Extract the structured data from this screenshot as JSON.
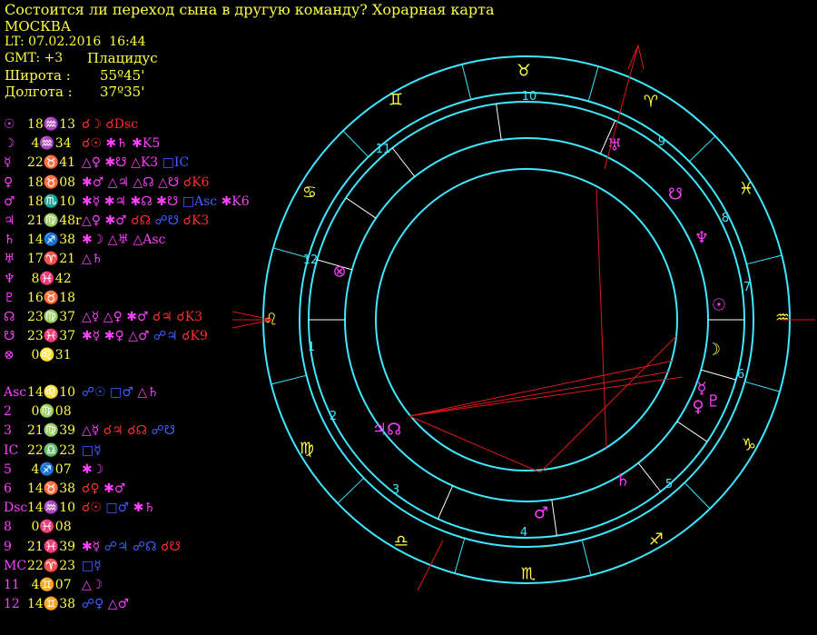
{
  "header": {
    "title": "Состоится ли переход сына в другую команду? Хорарная карта",
    "city": "МОСКВА",
    "lt": "LT: 07.02.2016  16:44",
    "gmt": "GMT: +3",
    "system": "Плацидус",
    "lat_label": "Широта :",
    "lat_value": "55º45'",
    "lon_label": "Долгота :",
    "lon_value": "37º35'"
  },
  "colors": {
    "text": "#ffff40",
    "magenta": "#ff40ff",
    "red": "#ff3030",
    "blue": "#4060ff",
    "cyan": "#40e8ff",
    "line": "#e01818"
  },
  "planets": [
    {
      "glyph": "☉",
      "pos": "18♒13",
      "aspects": [
        {
          "t": "☌☽ ☌Dsc",
          "c": "#ff3030"
        }
      ]
    },
    {
      "glyph": "☽",
      "pos": " 4♒34",
      "aspects": [
        {
          "t": "☌☉ ",
          "c": "#ff3030"
        },
        {
          "t": "✱♄ ✱K5",
          "c": "#ff40ff"
        }
      ]
    },
    {
      "glyph": "☿",
      "pos": "22♉41",
      "aspects": [
        {
          "t": "△♀ ✱☋ △K3 ",
          "c": "#ff40ff"
        },
        {
          "t": "□IC",
          "c": "#4060ff"
        }
      ]
    },
    {
      "glyph": "♀",
      "pos": "18♉08",
      "aspects": [
        {
          "t": "✱♂ △♃ △☊ △☋ ",
          "c": "#ff40ff"
        },
        {
          "t": "☌K6",
          "c": "#ff3030"
        }
      ]
    },
    {
      "glyph": "♂",
      "pos": "18♏10",
      "aspects": [
        {
          "t": "✱☿ ✱♃ ✱☊ ✱☋ ",
          "c": "#ff40ff"
        },
        {
          "t": "□Asc ",
          "c": "#4060ff"
        },
        {
          "t": "✱K6",
          "c": "#ff40ff"
        }
      ]
    },
    {
      "glyph": "♃",
      "pos": "21♍48r",
      "aspects": [
        {
          "t": "△♀ ✱♂ ",
          "c": "#ff40ff"
        },
        {
          "t": "☌☊ ",
          "c": "#ff3030"
        },
        {
          "t": "☍☋ ",
          "c": "#4060ff"
        },
        {
          "t": "☌K3",
          "c": "#ff3030"
        }
      ]
    },
    {
      "glyph": "♄",
      "pos": "14♐38",
      "aspects": [
        {
          "t": "✱☽ △♅ △Asc",
          "c": "#ff40ff"
        }
      ]
    },
    {
      "glyph": "♅",
      "pos": "17♈21",
      "aspects": [
        {
          "t": "△♄",
          "c": "#ff40ff"
        }
      ]
    },
    {
      "glyph": "♆",
      "pos": " 8♓42",
      "aspects": []
    },
    {
      "glyph": "♇",
      "pos": "16♉18",
      "aspects": []
    },
    {
      "glyph": "☊",
      "pos": "23♍37",
      "aspects": [
        {
          "t": "△☿ △♀ ✱♂ ",
          "c": "#ff40ff"
        },
        {
          "t": "☌♃ ☌K3",
          "c": "#ff3030"
        }
      ]
    },
    {
      "glyph": "☋",
      "pos": "23♓37",
      "aspects": [
        {
          "t": "✱☿ ✱♀ △♂ ",
          "c": "#ff40ff"
        },
        {
          "t": "☍♃ ",
          "c": "#4060ff"
        },
        {
          "t": "☌K9",
          "c": "#ff3030"
        }
      ]
    },
    {
      "glyph": "⊗",
      "pos": " 0♌31",
      "aspects": []
    }
  ],
  "houses": [
    {
      "label": "Asc",
      "pos": "14♌10",
      "aspects": [
        {
          "t": "☍☉ □♂ ",
          "c": "#4060ff"
        },
        {
          "t": "△♄",
          "c": "#ff40ff"
        }
      ]
    },
    {
      "label": "2",
      "pos": " 0♍08",
      "aspects": []
    },
    {
      "label": "3",
      "pos": "21♍39",
      "aspects": [
        {
          "t": "△☿ ",
          "c": "#ff40ff"
        },
        {
          "t": "☌♃ ☌☊ ",
          "c": "#ff3030"
        },
        {
          "t": "☍☋",
          "c": "#4060ff"
        }
      ]
    },
    {
      "label": "IC",
      "pos": "22♎23",
      "aspects": [
        {
          "t": "□☿",
          "c": "#4060ff"
        }
      ]
    },
    {
      "label": "5",
      "pos": " 4♐07",
      "aspects": [
        {
          "t": "✱☽",
          "c": "#ff40ff"
        }
      ]
    },
    {
      "label": "6",
      "pos": "14♉38",
      "aspects": [
        {
          "t": "☌♀ ",
          "c": "#ff3030"
        },
        {
          "t": "✱♂",
          "c": "#ff40ff"
        }
      ]
    },
    {
      "label": "Dsc",
      "pos": "14♒10",
      "aspects": [
        {
          "t": "☌☉ ",
          "c": "#ff3030"
        },
        {
          "t": "□♂ ",
          "c": "#4060ff"
        },
        {
          "t": "✱♄",
          "c": "#ff40ff"
        }
      ]
    },
    {
      "label": "8",
      "pos": " 0♓08",
      "aspects": []
    },
    {
      "label": "9",
      "pos": "21♓39",
      "aspects": [
        {
          "t": "✱☿ ",
          "c": "#ff40ff"
        },
        {
          "t": "☍♃ ☍☊ ",
          "c": "#4060ff"
        },
        {
          "t": "☌☋",
          "c": "#ff3030"
        }
      ]
    },
    {
      "label": "MC",
      "pos": "22♈23",
      "aspects": [
        {
          "t": "□☿",
          "c": "#4060ff"
        }
      ]
    },
    {
      "label": "11",
      "pos": " 4♊07",
      "aspects": [
        {
          "t": "△☽",
          "c": "#ff40ff"
        }
      ]
    },
    {
      "label": "12",
      "pos": "14♊38",
      "aspects": [
        {
          "t": "☍♀ ",
          "c": "#4060ff"
        },
        {
          "t": "△♂",
          "c": "#ff40ff"
        }
      ]
    }
  ],
  "wheel": {
    "house_numbers": [
      "1",
      "2",
      "3",
      "4",
      "5",
      "6",
      "7",
      "8",
      "9",
      "10",
      "11",
      "12"
    ],
    "signs": [
      {
        "glyph": "♉",
        "name": "taurus-sign"
      },
      {
        "glyph": "♈",
        "name": "aries-sign"
      },
      {
        "glyph": "♓",
        "name": "pisces-sign"
      },
      {
        "glyph": "♒",
        "name": "aquarius-sign"
      },
      {
        "glyph": "♑",
        "name": "capricorn-sign"
      },
      {
        "glyph": "♐",
        "name": "sagittarius-sign"
      },
      {
        "glyph": "♏",
        "name": "scorpio-sign"
      },
      {
        "glyph": "♎",
        "name": "libra-sign"
      },
      {
        "glyph": "♍",
        "name": "virgo-sign"
      },
      {
        "glyph": "♌",
        "name": "leo-sign"
      },
      {
        "glyph": "♋",
        "name": "cancer-sign"
      },
      {
        "glyph": "♊",
        "name": "gemini-sign"
      }
    ],
    "bodies": [
      {
        "glyph": "♅",
        "name": "uranus-glyph",
        "color": "#ff40ff"
      },
      {
        "glyph": "☋",
        "name": "south-node-glyph",
        "color": "#ff40ff"
      },
      {
        "glyph": "♆",
        "name": "neptune-glyph",
        "color": "#ff40ff"
      },
      {
        "glyph": "☉",
        "name": "sun-glyph",
        "color": "#ff40ff"
      },
      {
        "glyph": "☽",
        "name": "moon-glyph",
        "color": "#ffff40"
      },
      {
        "glyph": "☿",
        "name": "mercury-glyph",
        "color": "#ff40ff"
      },
      {
        "glyph": "♀",
        "name": "venus-glyph",
        "color": "#ff40ff"
      },
      {
        "glyph": "♇",
        "name": "pluto-glyph",
        "color": "#ff40ff"
      },
      {
        "glyph": "♄",
        "name": "saturn-glyph",
        "color": "#ff40ff"
      },
      {
        "glyph": "♂",
        "name": "mars-glyph",
        "color": "#ff40ff"
      },
      {
        "glyph": "♃☊",
        "name": "jupiter-node-glyph",
        "color": "#ff40ff"
      },
      {
        "glyph": "⊗",
        "name": "fortune-glyph",
        "color": "#ff40ff"
      }
    ]
  }
}
